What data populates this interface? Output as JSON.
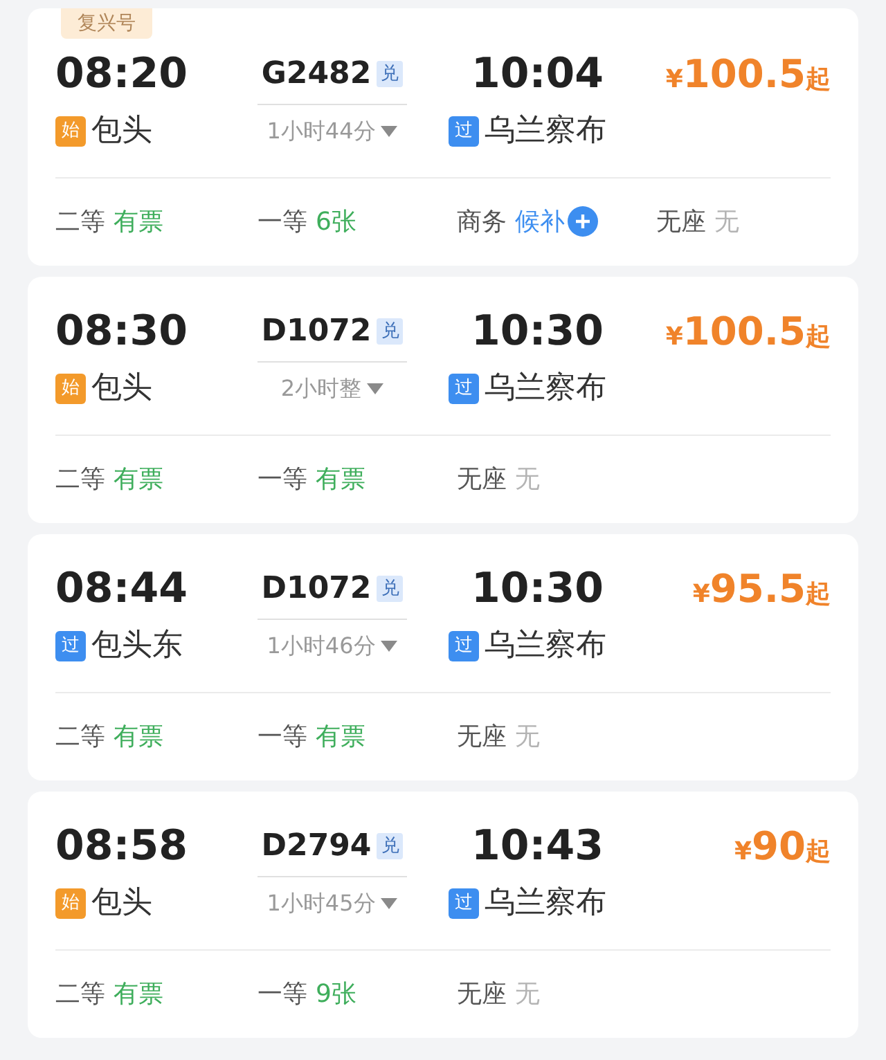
{
  "trains": [
    {
      "tag": "复兴号",
      "depart_time": "08:20",
      "train_no": "G2482",
      "exchange_badge": "兑",
      "arrive_time": "10:04",
      "price_symbol": "¥",
      "price": "100.5",
      "price_suffix": "起",
      "from": {
        "badge": "始",
        "kind": "start",
        "name": "包头"
      },
      "duration": "1小时44分",
      "to": {
        "badge": "过",
        "kind": "pass",
        "name": "乌兰察布"
      },
      "seats": [
        {
          "class": "二等",
          "status": "有票",
          "kind": "available"
        },
        {
          "class": "一等",
          "status": "6张",
          "kind": "available"
        },
        {
          "class": "商务",
          "status": "候补",
          "kind": "waitlist"
        },
        {
          "class": "无座",
          "status": "无",
          "kind": "none"
        }
      ]
    },
    {
      "depart_time": "08:30",
      "train_no": "D1072",
      "exchange_badge": "兑",
      "arrive_time": "10:30",
      "price_symbol": "¥",
      "price": "100.5",
      "price_suffix": "起",
      "from": {
        "badge": "始",
        "kind": "start",
        "name": "包头"
      },
      "duration": "2小时整",
      "to": {
        "badge": "过",
        "kind": "pass",
        "name": "乌兰察布"
      },
      "seats": [
        {
          "class": "二等",
          "status": "有票",
          "kind": "available"
        },
        {
          "class": "一等",
          "status": "有票",
          "kind": "available"
        },
        {
          "class": "无座",
          "status": "无",
          "kind": "none"
        }
      ]
    },
    {
      "depart_time": "08:44",
      "train_no": "D1072",
      "exchange_badge": "兑",
      "arrive_time": "10:30",
      "price_symbol": "¥",
      "price": "95.5",
      "price_suffix": "起",
      "from": {
        "badge": "过",
        "kind": "pass",
        "name": "包头东"
      },
      "duration": "1小时46分",
      "to": {
        "badge": "过",
        "kind": "pass",
        "name": "乌兰察布"
      },
      "seats": [
        {
          "class": "二等",
          "status": "有票",
          "kind": "available"
        },
        {
          "class": "一等",
          "status": "有票",
          "kind": "available"
        },
        {
          "class": "无座",
          "status": "无",
          "kind": "none"
        }
      ]
    },
    {
      "depart_time": "08:58",
      "train_no": "D2794",
      "exchange_badge": "兑",
      "arrive_time": "10:43",
      "price_symbol": "¥",
      "price": "90",
      "price_suffix": "起",
      "from": {
        "badge": "始",
        "kind": "start",
        "name": "包头"
      },
      "duration": "1小时45分",
      "to": {
        "badge": "过",
        "kind": "pass",
        "name": "乌兰察布"
      },
      "seats": [
        {
          "class": "二等",
          "status": "有票",
          "kind": "available"
        },
        {
          "class": "一等",
          "status": "9张",
          "kind": "available"
        },
        {
          "class": "无座",
          "status": "无",
          "kind": "none"
        }
      ]
    }
  ]
}
